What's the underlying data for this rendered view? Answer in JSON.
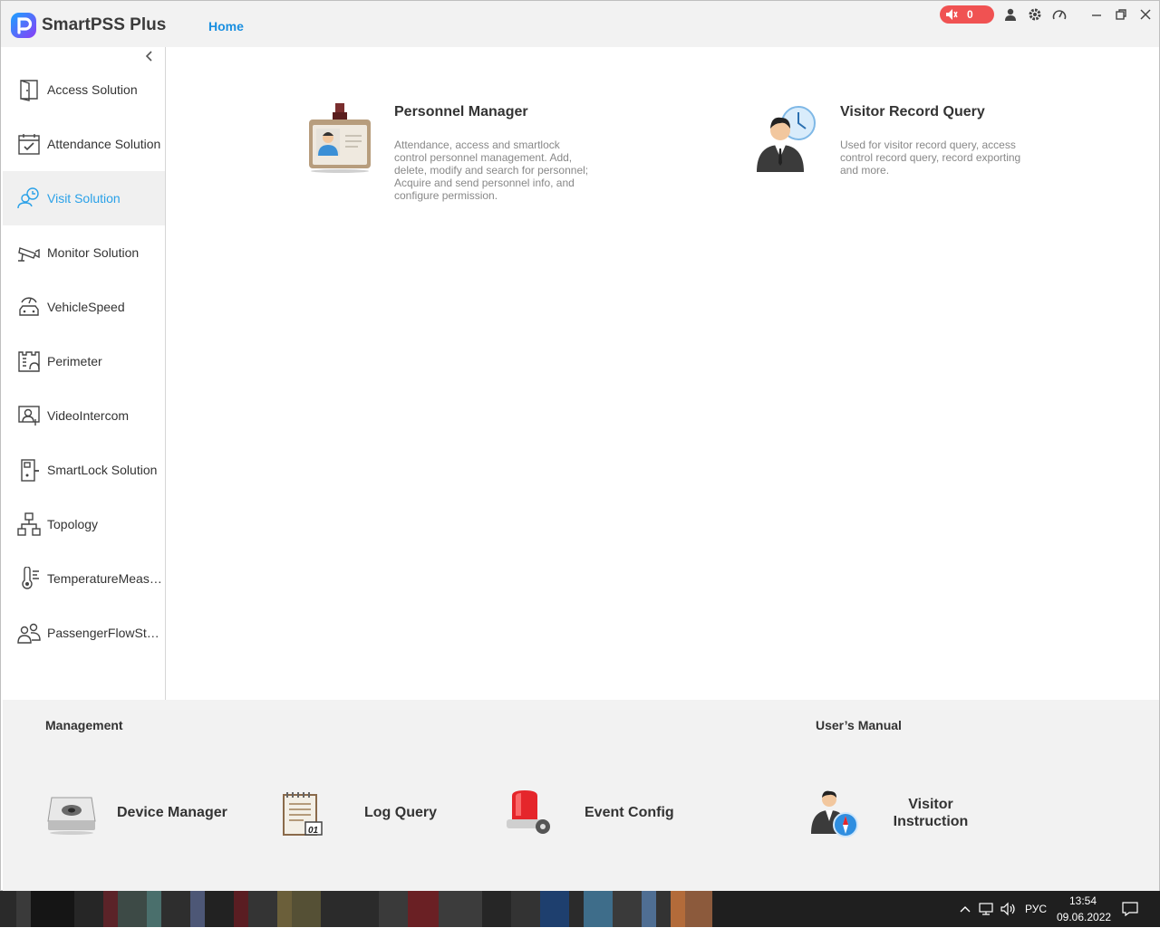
{
  "titlebar": {
    "app_name": "SmartPSS Plus",
    "home_tab": "Home",
    "alarm_count": "0",
    "icons": [
      "user-icon",
      "gear-icon",
      "speedometer-icon",
      "minimize-icon",
      "restore-icon",
      "close-icon"
    ]
  },
  "sidebar": {
    "items": [
      {
        "label": "Access Solution",
        "icon": "door-icon"
      },
      {
        "label": "Attendance Solution",
        "icon": "calendar-check-icon"
      },
      {
        "label": "Visit Solution",
        "icon": "visitor-clock-icon",
        "active": true
      },
      {
        "label": "Monitor Solution",
        "icon": "camera-icon"
      },
      {
        "label": "VehicleSpeed",
        "icon": "car-speed-icon"
      },
      {
        "label": "Perimeter",
        "icon": "perimeter-icon"
      },
      {
        "label": "VideoIntercom",
        "icon": "intercom-icon"
      },
      {
        "label": "SmartLock Solution",
        "icon": "smartlock-icon"
      },
      {
        "label": "Topology",
        "icon": "topology-icon"
      },
      {
        "label": "TemperatureMeas…",
        "icon": "thermometer-icon"
      },
      {
        "label": "PassengerFlowSt…",
        "icon": "people-icon"
      }
    ]
  },
  "main": {
    "cards": [
      {
        "title": "Personnel Manager",
        "desc": "Attendance,  access and smartlock control personnel management.  Add, delete, modify and search for personnel; Acquire and send personnel info, and configure permission."
      },
      {
        "title": "Visitor Record Query",
        "desc": "Used for visitor record query, access control record query, record exporting and more."
      }
    ]
  },
  "bottom": {
    "management_title": "Management",
    "manual_title": "User’s Manual",
    "management_items": [
      "Device Manager",
      "Log Query",
      "Event Config"
    ],
    "manual_item": "Visitor Instruction"
  },
  "taskbar": {
    "lang": "РУС",
    "time": "13:54",
    "date": "09.06.2022"
  },
  "colors": {
    "accent": "#1a8fe0",
    "active_text": "#2aa1e8",
    "alarm": "#f05252"
  }
}
